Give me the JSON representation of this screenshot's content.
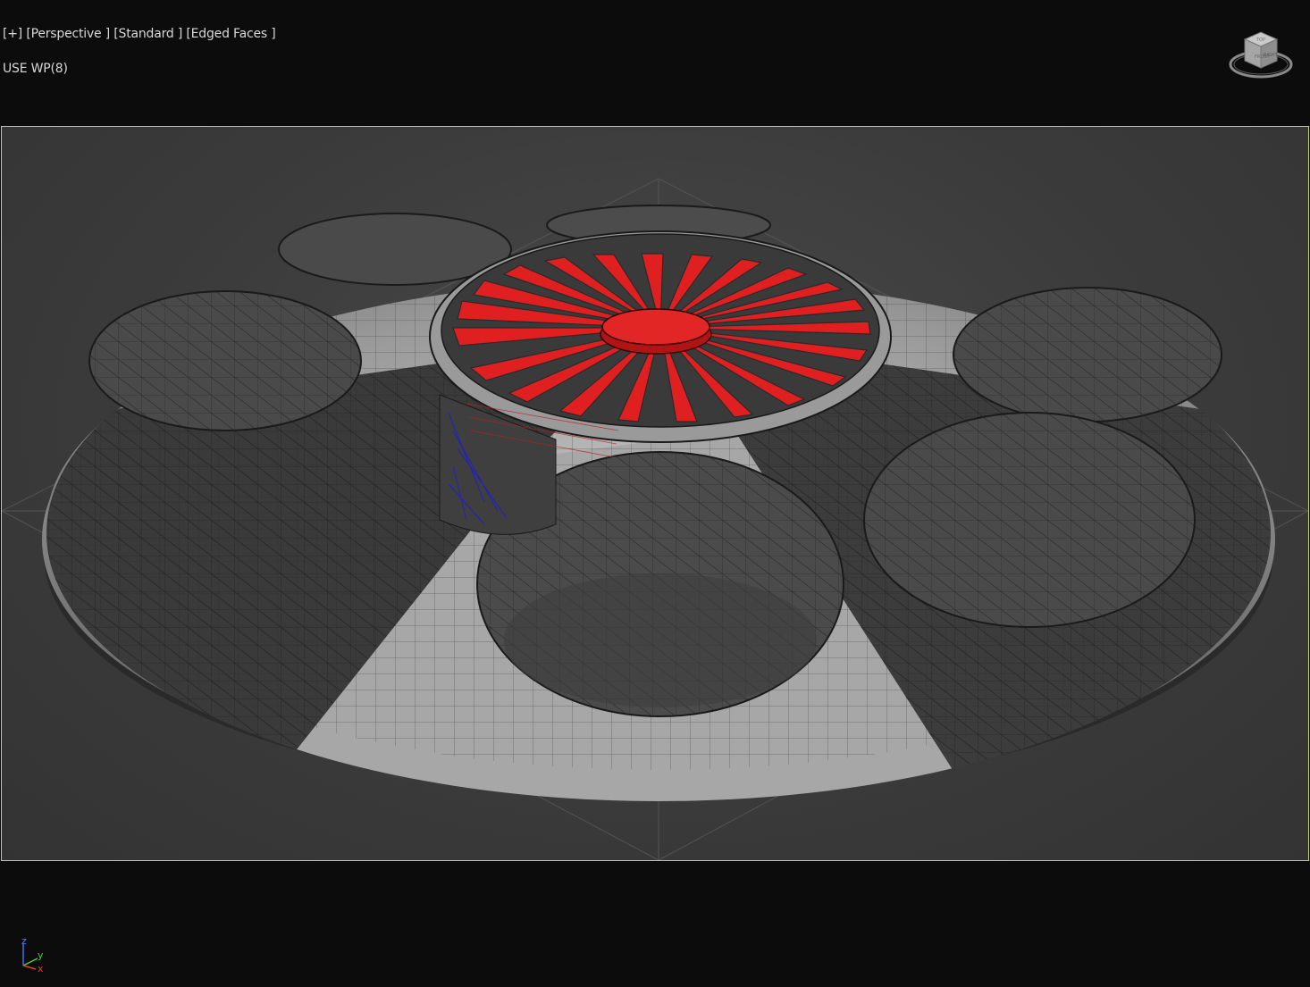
{
  "viewport": {
    "label_menu": "[+]",
    "label_view": "[Perspective ]",
    "label_shading": "[Standard ]",
    "label_display": "[Edged Faces ]",
    "workplane_status": "USE WP(8)"
  },
  "viewcube": {
    "icon": "viewcube-icon",
    "face_top": "TOP",
    "face_front": "FRONT",
    "face_right": "RIGHT"
  },
  "axis_tripod": {
    "icon": "axis-tripod-icon",
    "x": "x",
    "y": "y",
    "z": "z"
  },
  "colors": {
    "background": "#0c0c0c",
    "safe_frame_border": "#cfcf57",
    "viewport_bg": "#3e3e3e",
    "model_shell": "#9c9c9c",
    "model_dark_panel": "#3a3a3a",
    "fan_red": "#e02020",
    "wire_blue": "#2020c8"
  }
}
